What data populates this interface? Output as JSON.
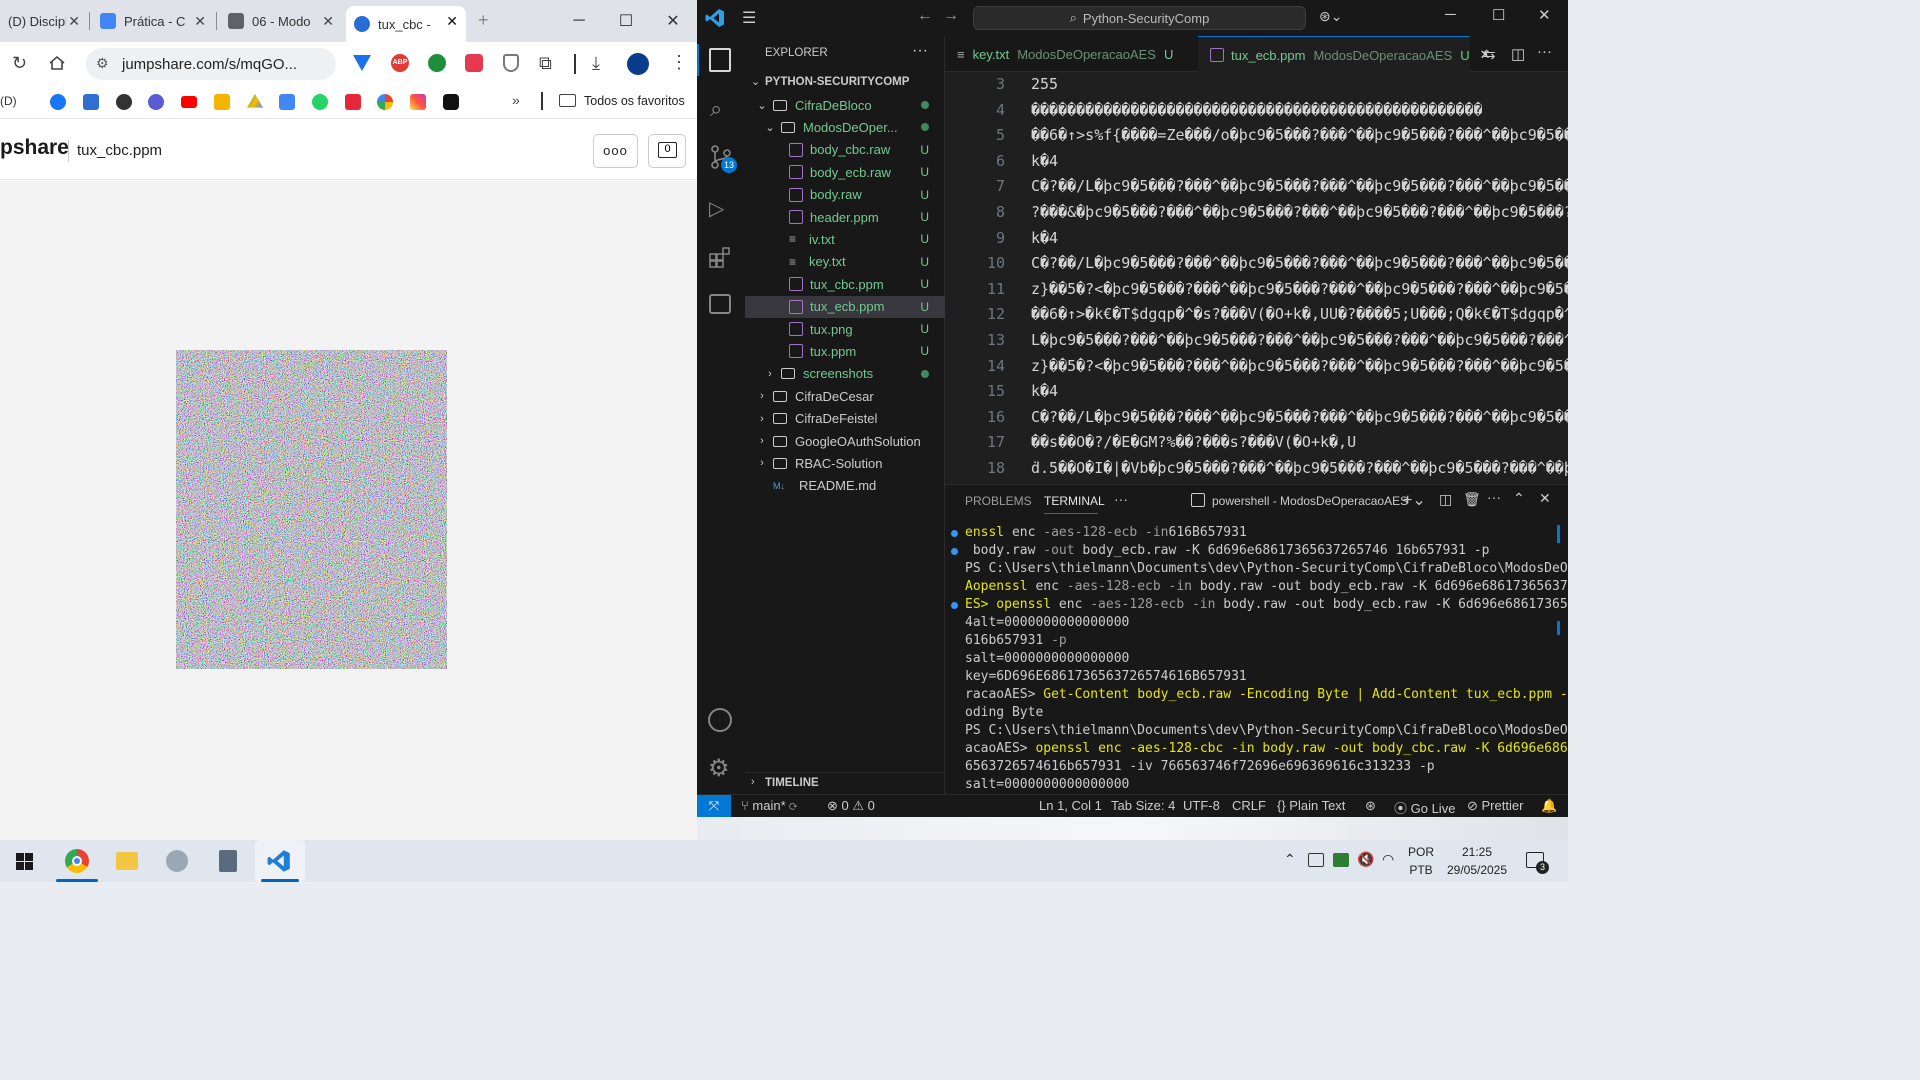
{
  "chrome": {
    "tabs": [
      {
        "title": "(D) Discipl",
        "favicon_color": "#888888"
      },
      {
        "title": "Prática - C",
        "favicon_color": "#4285f4"
      },
      {
        "title": "06 - Modo",
        "favicon_color": "#5f6368"
      },
      {
        "title": "tux_cbc -",
        "favicon_color": "#2b6cd4"
      }
    ],
    "new_tab": "+",
    "url": "jumpshare.com/s/mqGO...",
    "bookmarks_label_d": "(D)",
    "all_favorites": "Todos os favoritos",
    "site_logo": "pshare",
    "file_name": "tux_cbc.ppm",
    "more_button": "ooo",
    "comment_count": "0"
  },
  "vscode": {
    "search": "Python-SecurityComp",
    "explorer_title": "EXPLORER",
    "root": "PYTHON-SECURITYCOMP",
    "badge_count": "13",
    "tree": [
      {
        "label": "CifraDeBloco",
        "kind": "folder-open",
        "indent": 1,
        "status": "dot"
      },
      {
        "label": "ModosDeOper...",
        "kind": "folder-open",
        "indent": 2,
        "status": "dot"
      },
      {
        "label": "body_cbc.raw",
        "kind": "file",
        "indent": 3,
        "status": "U"
      },
      {
        "label": "body_ecb.raw",
        "kind": "file",
        "indent": 3,
        "status": "U"
      },
      {
        "label": "body.raw",
        "kind": "file",
        "indent": 3,
        "status": "U"
      },
      {
        "label": "header.ppm",
        "kind": "file",
        "indent": 3,
        "status": "U"
      },
      {
        "label": "iv.txt",
        "kind": "txt",
        "indent": 3,
        "status": "U"
      },
      {
        "label": "key.txt",
        "kind": "txt",
        "indent": 3,
        "status": "U"
      },
      {
        "label": "tux_cbc.ppm",
        "kind": "file",
        "indent": 3,
        "status": "U"
      },
      {
        "label": "tux_ecb.ppm",
        "kind": "file",
        "indent": 3,
        "status": "U",
        "selected": true
      },
      {
        "label": "tux.png",
        "kind": "file",
        "indent": 3,
        "status": "U"
      },
      {
        "label": "tux.ppm",
        "kind": "file",
        "indent": 3,
        "status": "U"
      },
      {
        "label": "screenshots",
        "kind": "folder",
        "indent": 2,
        "status": "dot"
      },
      {
        "label": "CifraDeCesar",
        "kind": "folder",
        "indent": 1,
        "status": ""
      },
      {
        "label": "CifraDeFeistel",
        "kind": "folder",
        "indent": 1,
        "status": ""
      },
      {
        "label": "GoogleOAuthSolution",
        "kind": "folder",
        "indent": 1,
        "status": ""
      },
      {
        "label": "RBAC-Solution",
        "kind": "folder",
        "indent": 1,
        "status": ""
      },
      {
        "label": "README.md",
        "kind": "md",
        "indent": 1,
        "status": ""
      }
    ],
    "timeline": "TIMELINE",
    "editor_tabs": [
      {
        "name": "key.txt",
        "path": "ModosDeOperacaoAES",
        "status": "U",
        "active": false
      },
      {
        "name": "tux_ecb.ppm",
        "path": "ModosDeOperacaoAES",
        "status": "U",
        "active": true
      }
    ],
    "code_lines": [
      {
        "n": "3",
        "text": "255"
      },
      {
        "n": "4",
        "text": "��������������������������������������������������"
      },
      {
        "n": "5",
        "text": "��6�↑>s%f{����=Ze���/o�þc9�5���?���^��þc9�5���?���^��þc9�5���?"
      },
      {
        "n": "6",
        "text": "k�4"
      },
      {
        "n": "7",
        "text": "C�?��/L�þc9�5���?���^��þc9�5���?���^��þc9�5���?���^��þc9�5���?"
      },
      {
        "n": "8",
        "text": "?���&�þc9�5���?���^��þc9�5���?���^��þc9�5���?���^��þc9�5���?"
      },
      {
        "n": "9",
        "text": "k�4"
      },
      {
        "n": "10",
        "text": "C�?��/L�þc9�5���?���^��þc9�5���?���^��þc9�5���?���^��þc9�5���?"
      },
      {
        "n": "11",
        "text": "z}��5�?<�þc9�5���?���^��þc9�5���?���^��þc9�5���?���^��þc9�5���?"
      },
      {
        "n": "12",
        "text": "��6�↑>�k€�T$dgqp�^�s?���V(�O+k�,UU�?����5;U���;Q�k€�T$dgqp�^�s"
      },
      {
        "n": "13",
        "text": "L�þc9�5���?���^��þc9�5���?���^��þc9�5���?���^��þc9�5���?���^��þ"
      },
      {
        "n": "14",
        "text": "z}��5�?<�þc9�5���?���^��þc9�5���?���^��þc9�5���?���^��þc9�5���?"
      },
      {
        "n": "15",
        "text": "k�4"
      },
      {
        "n": "16",
        "text": "C�?��/L�þc9�5���?���^��þc9�5���?���^��þc9�5���?���^��þc9�5���?"
      },
      {
        "n": "17",
        "text": "��s��O�?/�E�GM?%��?���s?���V(�O+k�,U"
      },
      {
        "n": "18",
        "text": "ḋ.5��O�I�|�Vb�þc9�5���?���^��þc9�5���?���^��þc9�5���?���^��þc9"
      }
    ],
    "panel_tabs": {
      "problems": "PROBLEMS",
      "terminal": "TERMINAL",
      "more": "···"
    },
    "terminal_label": "powershell - ModosDeOperacaoAES",
    "status": {
      "branch": "main*",
      "errors": "0",
      "warnings": "0",
      "position": "Ln 1, Col 1",
      "tab_size": "Tab Size: 4",
      "encoding": "UTF-8",
      "eol": "CRLF",
      "language": "Plain Text",
      "golive": "Go Live",
      "prettier": "Prettier"
    }
  },
  "terminal_lines": [
    {
      "a": "enssl",
      "b": " enc ",
      "c": "-aes-128-ecb -in",
      "d": "616B657931"
    },
    {
      "a": "",
      "b": " body.raw ",
      "c": "-out",
      "d": " body_ecb.raw -K 6d696e68617365637265746 16b657931 -p"
    },
    {
      "a": "",
      "b": "PS C:\\Users\\thielmann\\Documents\\dev\\Python-SecurityComp\\CifraDeBloco\\ModosDeOpe",
      "c": "",
      "d": ""
    },
    {
      "a": "Aopenssl",
      "b": " enc ",
      "c": "-aes-128-ecb -in",
      "d": " body.raw -out body_ecb.raw -K 6d696e6861736563726"
    },
    {
      "a": "ES> openssl",
      "b": " enc ",
      "c": "-aes-128-ecb -in",
      "d": " body.raw -out body_ecb.raw -K 6d696e6861736563"
    },
    {
      "a": "",
      "b": "4alt=0000000000000000",
      "c": "",
      "d": ""
    },
    {
      "a": "",
      "b": "616b657931 ",
      "c": "-p",
      "d": ""
    },
    {
      "a": "",
      "b": "salt=0000000000000000",
      "c": "",
      "d": ""
    },
    {
      "a": "",
      "b": "key=6D696E6861736563726574616B657931",
      "c": "",
      "d": ""
    },
    {
      "a": "",
      "b": "racaoAES> ",
      "c": "Get-Content body_ecb.raw -Encoding Byte | Add-Content tux_ecb.ppm -Enc",
      "d": ""
    },
    {
      "a": "",
      "b": "oding Byte",
      "c": "",
      "d": ""
    },
    {
      "a": "",
      "b": "PS C:\\Users\\thielmann\\Documents\\dev\\Python-SecurityComp\\CifraDeBloco\\ModosDeOper",
      "c": "",
      "d": ""
    },
    {
      "a": "",
      "b": "acaoAES> ",
      "c": "openssl enc -aes-128-cbc -in body.raw -out body_cbc.raw -K 6d696e686173",
      "d": ""
    },
    {
      "a": "",
      "b": "6563726574616b657931 -iv 766563746f72696e696369616c313233 -p",
      "c": "",
      "d": ""
    },
    {
      "a": "",
      "b": "salt=0000000000000000",
      "c": "",
      "d": ""
    }
  ],
  "taskbar": {
    "lang_top": "POR",
    "lang_bottom": "PTB",
    "time": "21:25",
    "date": "29/05/2025",
    "notif_count": "3"
  }
}
